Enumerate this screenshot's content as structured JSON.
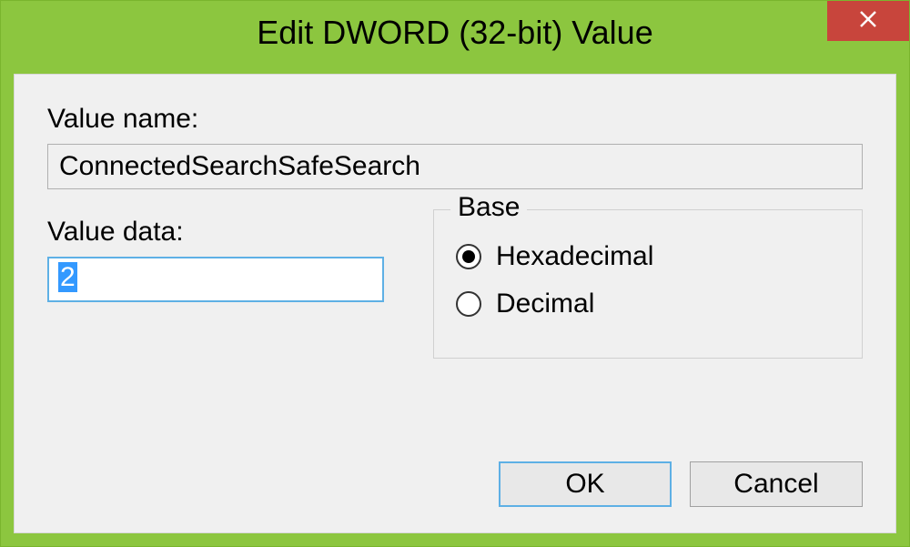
{
  "window": {
    "title": "Edit DWORD (32-bit) Value"
  },
  "labels": {
    "value_name": "Value name:",
    "value_data": "Value data:",
    "base": "Base"
  },
  "fields": {
    "value_name": "ConnectedSearchSafeSearch",
    "value_data": "2"
  },
  "base_options": {
    "hexadecimal": "Hexadecimal",
    "decimal": "Decimal",
    "selected": "hexadecimal"
  },
  "buttons": {
    "ok": "OK",
    "cancel": "Cancel"
  }
}
